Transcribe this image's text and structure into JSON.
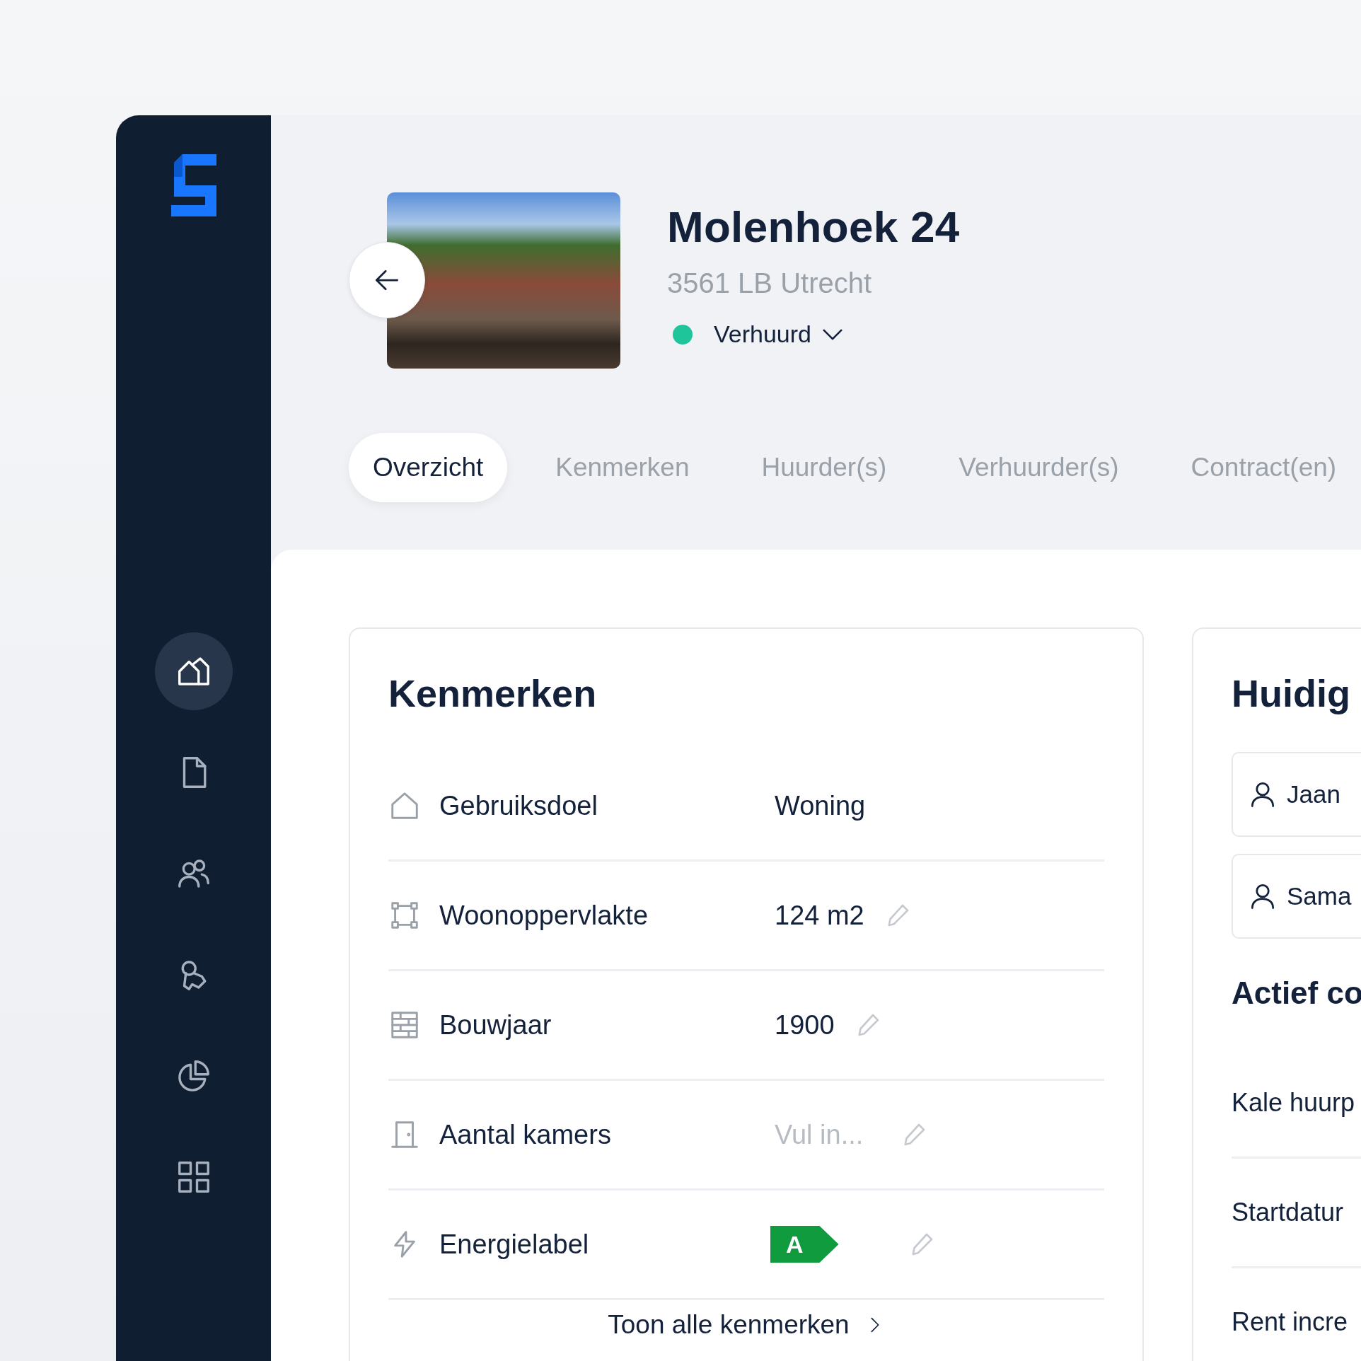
{
  "sidebar": {
    "items": [
      {
        "selected": true
      },
      {
        "selected": false
      },
      {
        "selected": false
      },
      {
        "selected": false
      },
      {
        "selected": false
      },
      {
        "selected": false
      }
    ]
  },
  "property": {
    "title": "Molenhoek 24",
    "address": "3561 LB Utrecht",
    "status": {
      "label": "Verhuurd",
      "color": "#1ec59a"
    }
  },
  "tabs": [
    {
      "label": "Overzicht",
      "selected": true
    },
    {
      "label": "Kenmerken",
      "selected": false
    },
    {
      "label": "Huurder(s)",
      "selected": false
    },
    {
      "label": "Verhuurder(s)",
      "selected": false
    },
    {
      "label": "Contract(en)",
      "selected": false
    }
  ],
  "kenmerken": {
    "title": "Kenmerken",
    "rows": [
      {
        "kind": "text",
        "label": "Gebruiksdoel",
        "value": "Woning",
        "editable": false
      },
      {
        "kind": "text",
        "label": "Woonoppervlakte",
        "value": "124 m2",
        "editable": true
      },
      {
        "kind": "text",
        "label": "Bouwjaar",
        "value": "1900",
        "editable": true
      },
      {
        "kind": "text",
        "label": "Aantal kamers",
        "placeholder": "Vul in...",
        "editable": true
      },
      {
        "kind": "energy_label",
        "label": "Energielabel",
        "value": "A",
        "editable": true
      }
    ],
    "link": "Toon alle kenmerken"
  },
  "current": {
    "title": "Huidig",
    "tenants": [
      "Jaan",
      "Sama"
    ],
    "contract_title": "Actief co",
    "contract_rows": [
      "Kale huurp",
      "Startdatur",
      "Rent incre"
    ]
  }
}
